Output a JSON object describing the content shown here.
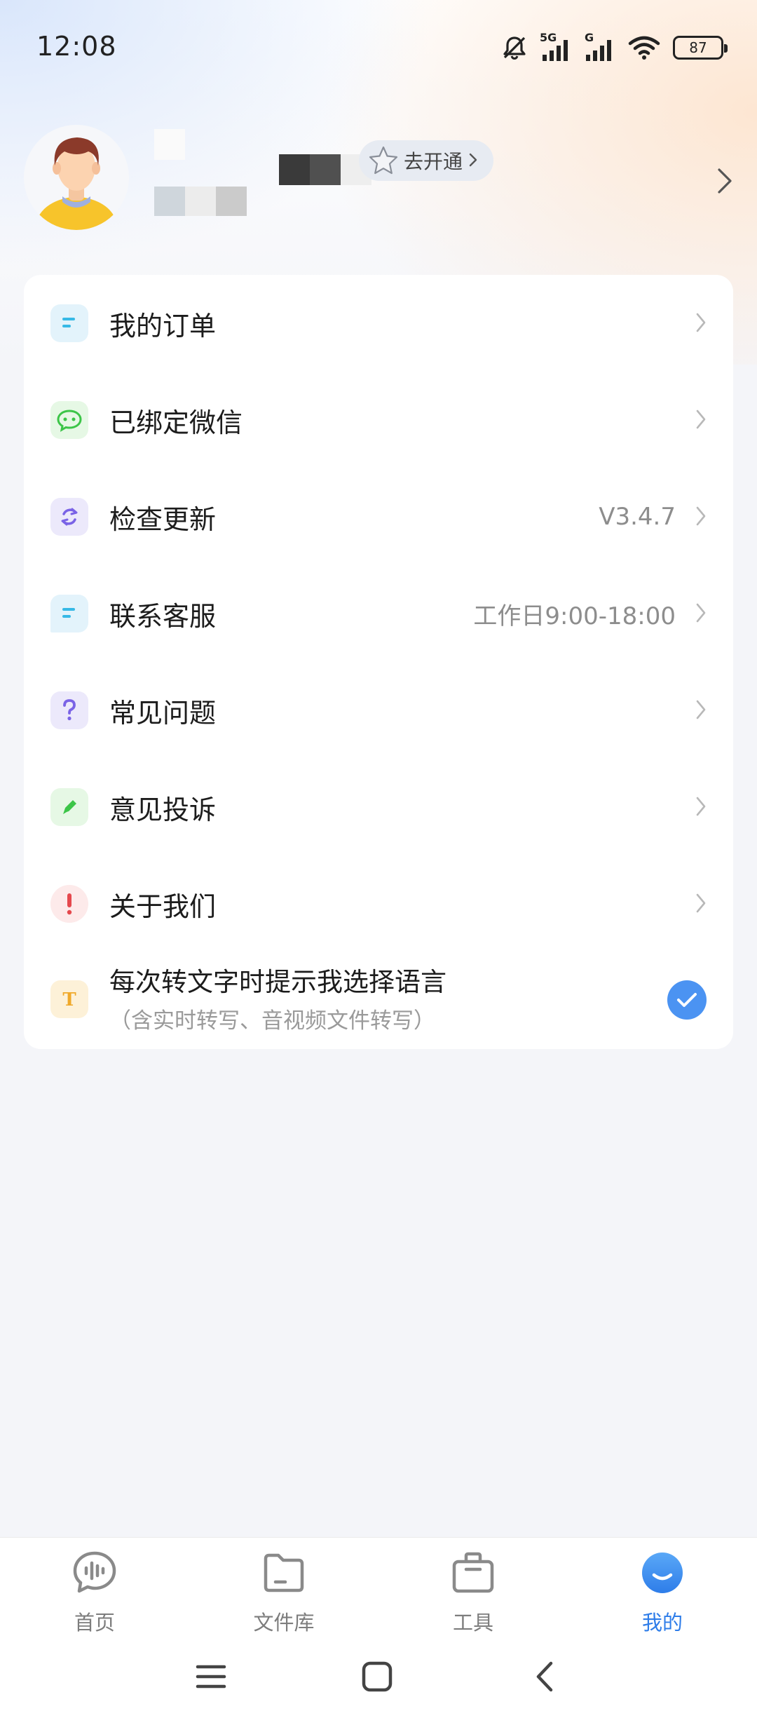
{
  "status_bar": {
    "time": "12:08",
    "network1": "5G",
    "network2": "G",
    "battery": "87",
    "icons": [
      "mute-bell-icon",
      "signal-5g-icon",
      "signal-icon",
      "wifi-icon",
      "battery-icon"
    ]
  },
  "profile": {
    "vip_label": "去开通",
    "icons": [
      "avatar",
      "star-icon",
      "chevron-right-icon"
    ]
  },
  "menu": {
    "items": [
      {
        "label": "我的订单",
        "value": "",
        "icon": "order-icon",
        "icon_bg": "#e3f3fb",
        "icon_color": "#37b9e6"
      },
      {
        "label": "已绑定微信",
        "value": "",
        "icon": "wechat-icon",
        "icon_bg": "#e6f8e5",
        "icon_color": "#3cc548"
      },
      {
        "label": "检查更新",
        "value": "V3.4.7",
        "icon": "refresh-icon",
        "icon_bg": "#ece9fb",
        "icon_color": "#7a63e6"
      },
      {
        "label": "联系客服",
        "value": "工作日9:00-18:00",
        "icon": "service-chat-icon",
        "icon_bg": "#e3f3fb",
        "icon_color": "#37b9e6"
      },
      {
        "label": "常见问题",
        "value": "",
        "icon": "question-icon",
        "icon_bg": "#ece9fb",
        "icon_color": "#7a63e6"
      },
      {
        "label": "意见投诉",
        "value": "",
        "icon": "pencil-icon",
        "icon_bg": "#e6f8e5",
        "icon_color": "#3cc548"
      },
      {
        "label": "关于我们",
        "value": "",
        "icon": "exclamation-icon",
        "icon_bg": "#fdeaea",
        "icon_color": "#e5484d"
      }
    ],
    "language_prompt": {
      "title": "每次转文字时提示我选择语言",
      "subtitle": "（含实时转写、音视频文件转写）",
      "checked": true,
      "icon": "text-t-icon",
      "icon_bg": "#fdf1d8",
      "icon_color": "#f0a92a"
    }
  },
  "bottom_nav": {
    "items": [
      {
        "label": "首页",
        "icon": "voice-chat-icon",
        "active": false
      },
      {
        "label": "文件库",
        "icon": "folder-icon",
        "active": false
      },
      {
        "label": "工具",
        "icon": "toolbox-icon",
        "active": false
      },
      {
        "label": "我的",
        "icon": "smile-profile-icon",
        "active": true
      }
    ],
    "active_color": "#2e7de9",
    "inactive_color": "#7d7d7d"
  },
  "system_nav": {
    "icons": [
      "menu-lines-icon",
      "home-square-icon",
      "back-chevron-icon"
    ]
  }
}
